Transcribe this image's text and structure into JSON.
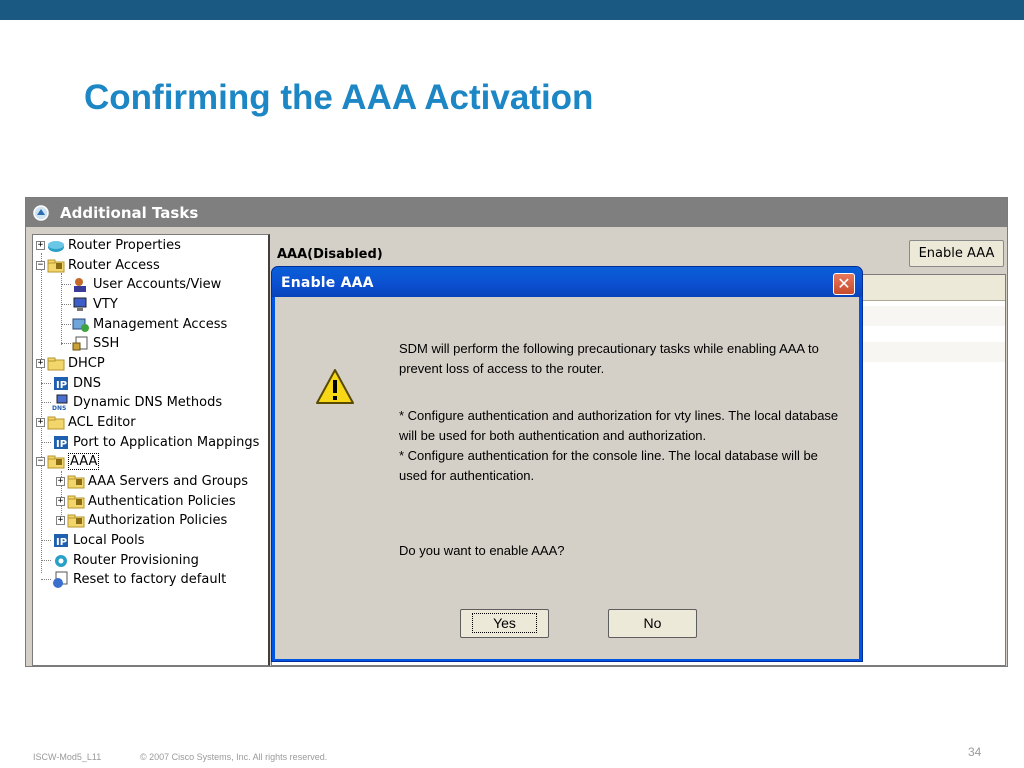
{
  "slide": {
    "title": "Confirming the AAA Activation",
    "footer_left": "ISCW-Mod5_L11",
    "footer_copyright": "© 2007 Cisco Systems, Inc. All rights reserved.",
    "page_number": "34"
  },
  "app": {
    "header_title": "Additional Tasks",
    "aaa_status": "AAA(Disabled)",
    "enable_button": "Enable AAA"
  },
  "tree": {
    "items": [
      {
        "label": "Router Properties",
        "icon": "router-icon"
      },
      {
        "label": "Router Access",
        "icon": "folder-lock-icon"
      },
      {
        "label": "User Accounts/View",
        "icon": "users-icon"
      },
      {
        "label": "VTY",
        "icon": "monitor-icon"
      },
      {
        "label": "Management Access",
        "icon": "management-icon"
      },
      {
        "label": "SSH",
        "icon": "ssh-lock-icon"
      },
      {
        "label": "DHCP",
        "icon": "folder-icon"
      },
      {
        "label": "DNS",
        "icon": "ip-icon"
      },
      {
        "label": "Dynamic DNS Methods",
        "icon": "dns-icon"
      },
      {
        "label": "ACL Editor",
        "icon": "folder-icon"
      },
      {
        "label": "Port to Application Mappings",
        "icon": "ip-icon"
      },
      {
        "label": "AAA",
        "icon": "folder-lock-icon"
      },
      {
        "label": "AAA Servers and Groups",
        "icon": "folder-lock-icon"
      },
      {
        "label": "Authentication Policies",
        "icon": "folder-lock-icon"
      },
      {
        "label": "Authorization Policies",
        "icon": "folder-lock-icon"
      },
      {
        "label": "Local Pools",
        "icon": "ip-icon"
      },
      {
        "label": "Router Provisioning",
        "icon": "provisioning-icon"
      },
      {
        "label": "Reset to factory default",
        "icon": "reset-icon"
      }
    ]
  },
  "dialog": {
    "title": "Enable AAA",
    "close_glyph": "✕",
    "message_1": "SDM will perform the following precautionary tasks while enabling AAA to prevent loss of access to the router.",
    "message_2a": "* Configure authentication and authorization for vty lines. The local database will be used for both authentication and authorization.",
    "message_2b": "* Configure authentication for the console line. The local database will be used for authentication.",
    "question": "Do you want to enable AAA?",
    "yes_label": "Yes",
    "no_label": "No"
  },
  "colors": {
    "top_bar": "#1a5a82",
    "title_blue": "#1d87c5",
    "xp_title_blue": "#0b4fd0"
  }
}
